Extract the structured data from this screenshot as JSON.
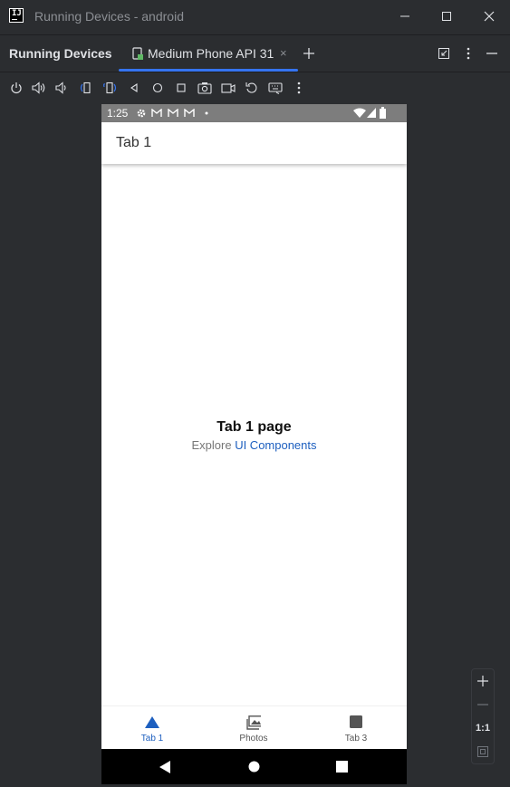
{
  "window": {
    "title": "Running Devices - android",
    "logo_text": "IJ"
  },
  "tool_window": {
    "title": "Running Devices",
    "tab": {
      "label": "Medium Phone API 31",
      "close": "×"
    }
  },
  "device_toolbar": {
    "icons": [
      "power-icon",
      "volume-up-icon",
      "volume-down-icon",
      "rotate-left-icon",
      "rotate-right-icon",
      "back-icon",
      "home-icon",
      "overview-icon",
      "screenshot-icon",
      "screen-record-icon",
      "reset-icon",
      "keyboard-icon",
      "more-icon"
    ]
  },
  "phone": {
    "status_bar": {
      "time": "1:25"
    },
    "app_bar": {
      "title": "Tab 1"
    },
    "content": {
      "title": "Tab 1 page",
      "subtitle_prefix": "Explore ",
      "subtitle_link": "UI Components"
    },
    "bottom_nav": [
      {
        "label": "Tab 1",
        "active": true
      },
      {
        "label": "Photos",
        "active": false
      },
      {
        "label": "Tab 3",
        "active": false
      }
    ]
  },
  "zoom_panel": {
    "one_to_one": "1:1"
  },
  "colors": {
    "ide_background": "#2b2d30",
    "accent": "#3574f0",
    "link": "#1d5fbf",
    "status_bar": "#7d7d7d"
  }
}
